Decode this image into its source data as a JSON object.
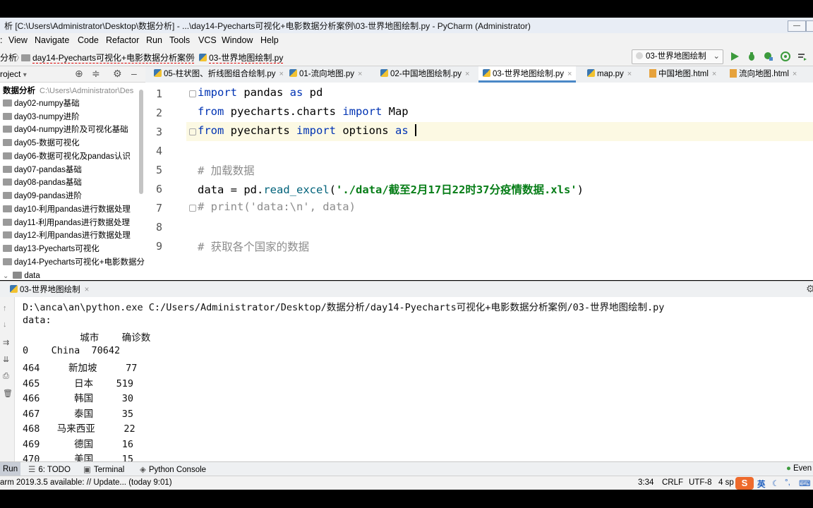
{
  "window": {
    "title": "析 [C:\\Users\\Administrator\\Desktop\\数据分析] - ...\\day14-Pyecharts可视化+电影数据分析案例\\03-世界地图绘制.py - PyCharm (Administrator)"
  },
  "menu": [
    "View",
    "Navigate",
    "Code",
    "Refactor",
    "Run",
    "Tools",
    "VCS",
    "Window",
    "Help"
  ],
  "breadcrumb": {
    "root": "分析",
    "folder": "day14-Pyecharts可视化+电影数据分析案例",
    "file": "03-世界地图绘制.py"
  },
  "run_config": "03-世界地图绘制",
  "project": {
    "header": "roject",
    "root_name": "数据分析",
    "root_path": "C:\\Users\\Administrator\\Des",
    "items": [
      "day02-numpy基础",
      "day03-numpy进阶",
      "day04-numpy进阶及可视化基础",
      "day05-数据可视化",
      "day06-数据可视化及pandas认识",
      "day07-pandas基础",
      "day08-pandas基础",
      "day09-pandas进阶",
      "day10-利用pandas进行数据处理",
      "day11-利用pandas进行数据处理",
      "day12-利用pandas进行数据处理",
      "day13-Pyecharts可视化",
      "day14-Pyecharts可视化+电影数据分",
      "data"
    ]
  },
  "tabs": [
    "05-柱状图、折线图组合绘制.py",
    "01-流向地图.py",
    "02-中国地图绘制.py",
    "03-世界地图绘制.py",
    "map.py",
    "中国地图.html",
    "流向地图.html"
  ],
  "editor": {
    "line_numbers": [
      "1",
      "2",
      "3",
      "4",
      "5",
      "6",
      "7",
      "8",
      "9"
    ],
    "line1": {
      "k1": "import",
      "t1": " pandas ",
      "k2": "as",
      "t2": " pd"
    },
    "line2": {
      "k1": "from",
      "t1": " pyecharts.charts ",
      "k2": "import",
      "t2": " Map"
    },
    "line3": {
      "k1": "from",
      "t1": " pyecharts ",
      "k2": "import",
      "t2": " options ",
      "k3": "as",
      "t3": " "
    },
    "line5": "# 加载数据",
    "line6": {
      "t1": "data = pd.",
      "fn": "read_excel",
      "t2": "(",
      "str": "'./data/截至2月17日22时37分疫情数据.xls'",
      "t3": ")"
    },
    "line7": "# print('data:\\n', data)",
    "line9": "# 获取各个国家的数据"
  },
  "run": {
    "tab_label": "03-世界地图绘制",
    "cmd": "D:\\anca\\an\\python.exe C:/Users/Administrator/Desktop/数据分析/day14-Pyecharts可视化+电影数据分析案例/03-世界地图绘制.py",
    "data_label": "data:",
    "header": "          城市    确诊数",
    "rows": [
      "0    China  70642",
      "464     新加坡     77",
      "465      日本    519",
      "466      韩国     30",
      "467      泰国     35",
      "468   马来西亚     22",
      "469      德国     16",
      "470      美国     15"
    ]
  },
  "bottom_tools": {
    "run": "Run",
    "todo": "6: TODO",
    "terminal": "Terminal",
    "python_console": "Python Console",
    "event": "Even"
  },
  "status": {
    "message": "arm 2019.3.5 available: // Update... (today 9:01)",
    "position": "3:34",
    "line_sep": "CRLF",
    "encoding": "UTF-8",
    "indent": "4 sp",
    "ime": "英"
  }
}
